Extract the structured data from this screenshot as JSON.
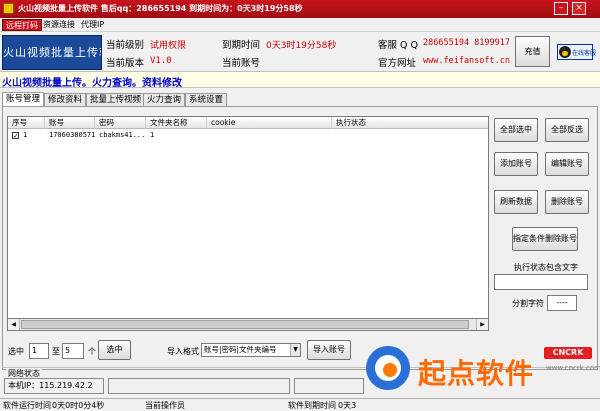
{
  "window": {
    "title": "火山视频批量上传软件 售后qq：286655194 到期时间为：0天3时19分58秒"
  },
  "menu": [
    "远程打码",
    "资源连接",
    "代理IP"
  ],
  "header": {
    "logo_text": "火山视频批量上传软件",
    "level_label": "当前级别",
    "level_value": "试用权限",
    "version_label": "当前版本",
    "version_value": "V1.0",
    "expire_label": "到期时间",
    "expire_value": "0天3时19分58秒",
    "account_label": "当前账号",
    "account_value": "",
    "service_label": "客服 Q Q",
    "service_value": "286655194 8199917",
    "site_label": "官方网址",
    "site_value": "www.feifansoft.cn",
    "recharge_label": "充值",
    "qq_badge_text": "在线客服"
  },
  "banner": "火山视频批量上传。火力查询。资料修改",
  "tabs": [
    "账号管理",
    "修改资料",
    "批量上传视频",
    "火力查询",
    "系统设置"
  ],
  "table": {
    "columns": [
      "序号",
      "账号",
      "密码",
      "文件夹名称",
      "cookie",
      "执行状态"
    ],
    "rows": [
      {
        "checked": "✓",
        "index": "1",
        "account": "17060380571",
        "password": "cbakms41...",
        "folder": "1",
        "cookie": "",
        "status": ""
      }
    ]
  },
  "side_buttons": {
    "select_all": "全部选中",
    "invert": "全部反选",
    "add": "添加账号",
    "edit": "编辑账号",
    "refresh": "刷新数据",
    "delete": "删除账号",
    "delete_cond": "指定条件删除账号",
    "status_contains_label": "执行状态包含文字",
    "status_contains_value": "",
    "separator_label": "分割字符",
    "separator_value": "----"
  },
  "bottom": {
    "select_from_label": "选中",
    "from_value": "1",
    "to_label": "至",
    "to_value": "5",
    "unit_label": "个",
    "select_button": "选中",
    "import_format_label": "导入格式",
    "import_format_value": "账号|密码|文件夹编号",
    "import_button": "导入账号"
  },
  "network": {
    "legend": "网络状态",
    "ip_text": "本机IP：115.219.42.2",
    "box2": "",
    "box3": ""
  },
  "statusbar": {
    "runtime_label": "软件运行时间",
    "runtime_value": "0天0时0分4秒",
    "current_label": "当前操作员",
    "expire_label": "软件到期时间",
    "expire_value": "0天3"
  },
  "watermark": {
    "text": "起点软件",
    "badge": "CNCRK",
    "domain": "www.cncrk.com"
  }
}
